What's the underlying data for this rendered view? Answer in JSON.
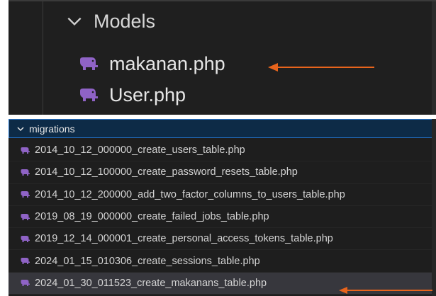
{
  "colors": {
    "accent_arrow": "#e8641c",
    "php_icon": "#8f63c6",
    "header_border": "#2472c8"
  },
  "top_panel": {
    "folder": {
      "label": "Models",
      "icon": "chevron-down-icon"
    },
    "files": [
      {
        "label": "makanan.php",
        "icon": "php-elephant-icon",
        "annotated": true
      },
      {
        "label": "User.php",
        "icon": "php-elephant-icon",
        "annotated": false
      }
    ]
  },
  "bottom_panel": {
    "section": {
      "label": "migrations",
      "icon": "chevron-down-icon"
    },
    "files": [
      {
        "label": "2014_10_12_000000_create_users_table.php"
      },
      {
        "label": "2014_10_12_100000_create_password_resets_table.php"
      },
      {
        "label": "2014_10_12_200000_add_two_factor_columns_to_users_table.php"
      },
      {
        "label": "2019_08_19_000000_create_failed_jobs_table.php"
      },
      {
        "label": "2019_12_14_000001_create_personal_access_tokens_table.php"
      },
      {
        "label": "2024_01_15_010306_create_sessions_table.php"
      },
      {
        "label": "2024_01_30_011523_create_makanans_table.php",
        "annotated": true
      }
    ]
  }
}
